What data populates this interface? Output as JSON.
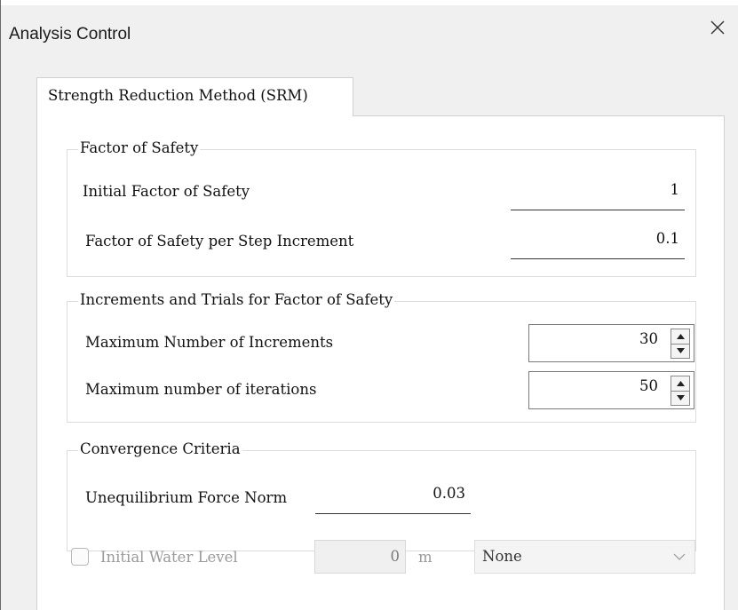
{
  "window": {
    "title": "Analysis Control",
    "close_icon": "close-icon"
  },
  "tabs": [
    {
      "label": "Strength Reduction Method (SRM)",
      "active": true
    }
  ],
  "factor_of_safety": {
    "legend": "Factor of Safety",
    "initial_label": "Initial Factor of Safety",
    "initial_value": "1",
    "increment_label": "Factor of Safety per Step Increment",
    "increment_value": "0.1"
  },
  "increments": {
    "legend": "Increments and Trials for Factor of Safety",
    "max_increments_label": "Maximum Number of Increments",
    "max_increments_value": "30",
    "max_iterations_label": "Maximum number of iterations",
    "max_iterations_value": "50"
  },
  "convergence": {
    "legend": "Convergence Criteria",
    "norm_label": "Unequilibrium Force Norm",
    "norm_value": "0.03"
  },
  "water_level": {
    "checkbox_label": "Initial Water Level",
    "checked": false,
    "value": "0",
    "unit": "m",
    "combo_value": "None"
  },
  "colors": {
    "window_bg": "#f0f0f0",
    "panel_bg": "#ffffff",
    "disabled_text": "#9a9a9a"
  }
}
